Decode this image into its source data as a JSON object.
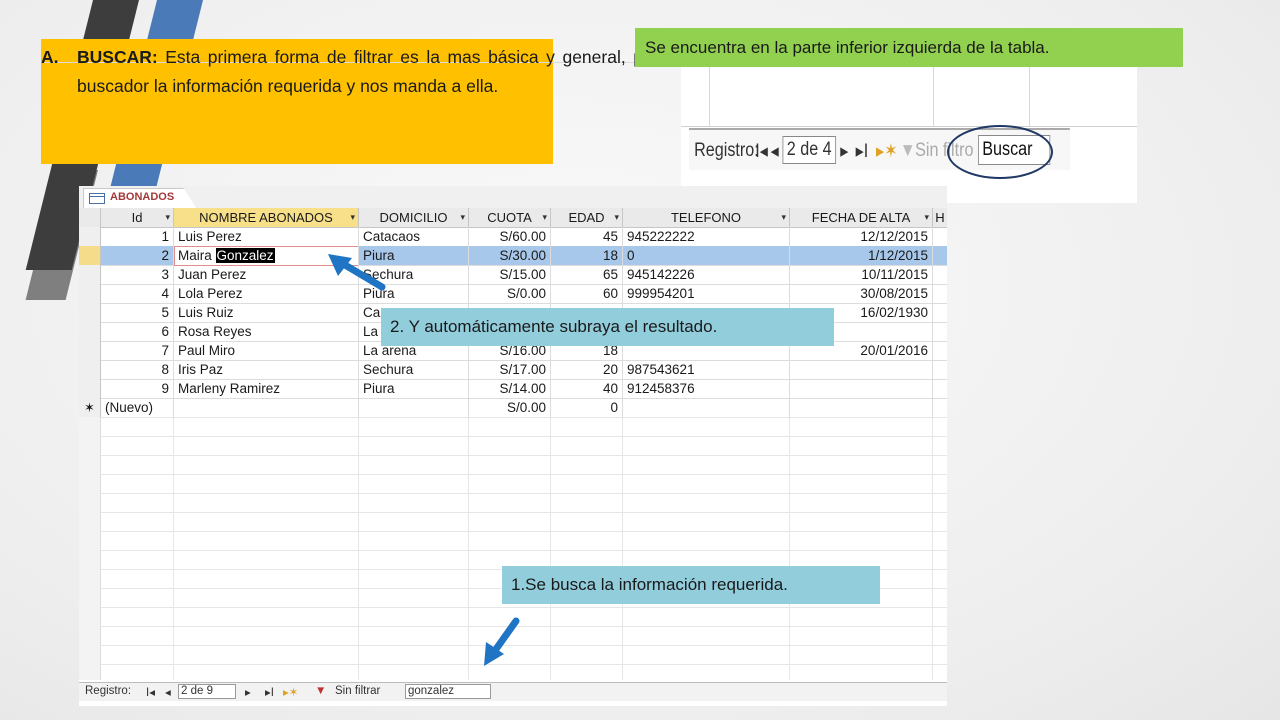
{
  "callout_a": {
    "letter": "A.",
    "keyword": "BUSCAR:",
    "text": "Esta primera forma de filtrar es la mas básica y general, pues solo consta de escribir en el buscador la información requerida y nos manda a ella."
  },
  "callout_green": "Se encuentra en la parte inferior izquierda de la tabla.",
  "callout_result": "2. Y automáticamente subraya el resultado.",
  "callout_search": "1.Se busca la información requerida.",
  "zoom_nav": {
    "label": "Registro:",
    "first": "I◂",
    "prev": "◂",
    "record": "2 de 4",
    "next": "▸",
    "last": "▸I",
    "new": "▸✶",
    "filter": "Sin filtro",
    "search": "Buscar"
  },
  "table": {
    "tab_label": "ABONADOS",
    "columns": [
      "Id",
      "NOMBRE ABONADOS",
      "DOMICILIO",
      "CUOTA",
      "EDAD",
      "TELEFONO",
      "FECHA DE ALTA",
      "H"
    ],
    "rows": [
      {
        "id": "1",
        "nombre_a": "Luis Perez",
        "nombre_b": "",
        "domicilio": "Catacaos",
        "cuota": "S/60.00",
        "edad": "45",
        "telefono": "945222222",
        "fecha": "12/12/2015"
      },
      {
        "id": "2",
        "nombre_a": "Maira ",
        "nombre_b": "Gonzalez",
        "domicilio": "Piura",
        "cuota": "S/30.00",
        "edad": "18",
        "telefono": "0",
        "fecha": "1/12/2015"
      },
      {
        "id": "3",
        "nombre_a": "Juan Perez",
        "nombre_b": "",
        "domicilio": "Sechura",
        "cuota": "S/15.00",
        "edad": "65",
        "telefono": "945142226",
        "fecha": "10/11/2015"
      },
      {
        "id": "4",
        "nombre_a": " Lola Perez",
        "nombre_b": "",
        "domicilio": "Piura",
        "cuota": "S/0.00",
        "edad": "60",
        "telefono": "999954201",
        "fecha": "30/08/2015"
      },
      {
        "id": "5",
        "nombre_a": "Luis Ruiz",
        "nombre_b": "",
        "domicilio": "Ca",
        "cuota": "",
        "edad": "",
        "telefono": "",
        "fecha": "16/02/1930"
      },
      {
        "id": "6",
        "nombre_a": "Rosa Reyes",
        "nombre_b": "",
        "domicilio": "La",
        "cuota": "",
        "edad": "",
        "telefono": "",
        "fecha": ""
      },
      {
        "id": "7",
        "nombre_a": "Paul Miro",
        "nombre_b": "",
        "domicilio": "La arena",
        "cuota": "S/16.00",
        "edad": "18",
        "telefono": "",
        "fecha": "20/01/2016"
      },
      {
        "id": "8",
        "nombre_a": "Iris Paz",
        "nombre_b": "",
        "domicilio": "Sechura",
        "cuota": "S/17.00",
        "edad": "20",
        "telefono": "987543621",
        "fecha": ""
      },
      {
        "id": "9",
        "nombre_a": "Marleny Ramirez",
        "nombre_b": "",
        "domicilio": "Piura",
        "cuota": "S/14.00",
        "edad": "40",
        "telefono": "912458376",
        "fecha": ""
      }
    ],
    "new_row": {
      "marker": "✶",
      "id": "(Nuevo)",
      "cuota": "S/0.00",
      "edad": "0"
    },
    "status": {
      "label": "Registro:",
      "first": "I◂",
      "prev": "◂",
      "record": "2 de 9",
      "next": "▸",
      "last": "▸I",
      "new": "▸✶",
      "filter": "Sin filtrar",
      "search_value": "gonzalez"
    }
  },
  "colors": {
    "yellow": "#ffc000",
    "green": "#92d050",
    "light_blue": "#92cddc",
    "arrow_blue": "#1f75c4",
    "ellipse": "#1f3864"
  }
}
